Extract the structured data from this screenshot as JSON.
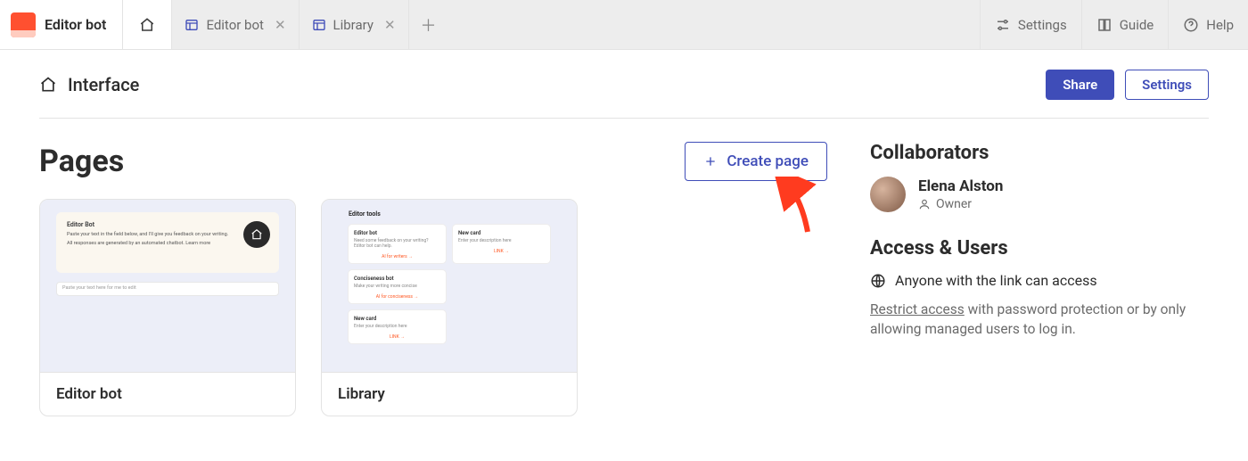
{
  "topbar": {
    "brand": "Editor bot",
    "tabs": [
      {
        "label": "Editor bot"
      },
      {
        "label": "Library"
      }
    ],
    "settings": "Settings",
    "guide": "Guide",
    "help": "Help"
  },
  "header": {
    "title": "Interface",
    "share": "Share",
    "settings": "Settings"
  },
  "pages": {
    "title": "Pages",
    "create": "Create page",
    "cards": [
      {
        "label": "Editor bot"
      },
      {
        "label": "Library"
      }
    ],
    "preview1": {
      "title": "Editor Bot",
      "sub": "Paste your text in the field below, and I'll give you feedback on your writing.",
      "note": "All responses are generated by an automated chatbot. Learn more",
      "placeholder": "Paste your text here for me to edit"
    },
    "preview2": {
      "title": "Editor tools",
      "cards": [
        {
          "t": "Editor bot",
          "s": "Need some feedback on your writing? Editor bot can help.",
          "l": "AI for writers →"
        },
        {
          "t": "New card",
          "s": "Enter your description here",
          "l": "LINK →"
        },
        {
          "t": "Conciseness bot",
          "s": "Make your writing more concise",
          "l": "AI for conciseness →"
        },
        {
          "t": "New card",
          "s": "Enter your description here",
          "l": "LINK →"
        }
      ]
    }
  },
  "collaborators": {
    "heading": "Collaborators",
    "name": "Elena Alston",
    "role": "Owner"
  },
  "access": {
    "heading": "Access & Users",
    "status": "Anyone with the link can access",
    "restrict_link": "Restrict access",
    "restrict_rest": " with password protection or by only allowing managed users to log in."
  }
}
